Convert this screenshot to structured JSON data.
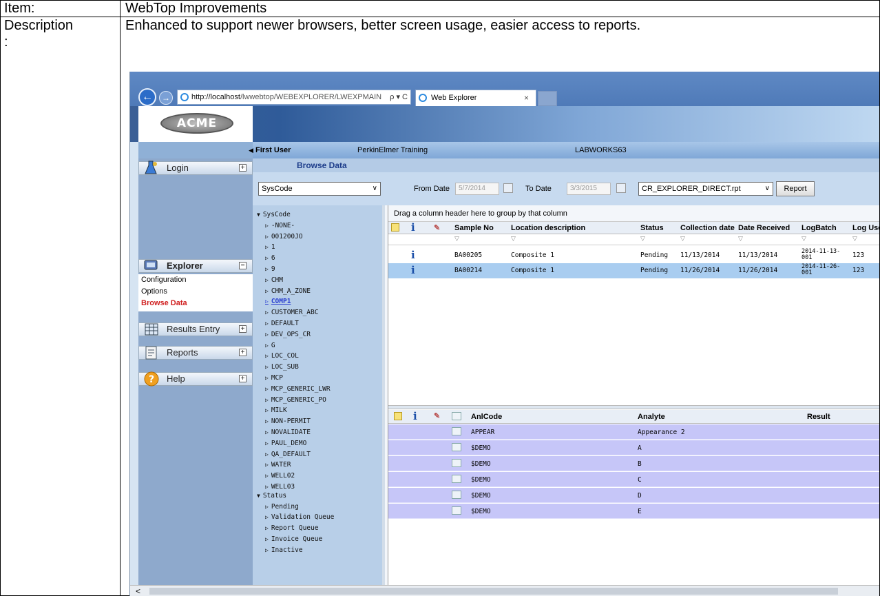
{
  "doc": {
    "item_label": "Item:",
    "item_value": "WebTop Improvements",
    "desc_label": "Description",
    "desc_colon": ":",
    "desc_value": "Enhanced to support newer browsers, better screen usage, easier access to reports."
  },
  "browser": {
    "url_host": "http://localhost",
    "url_path": "/lwwebtop/WEBEXPLORER/LWEXPMAIN",
    "url_controls": "ρ ▾ C",
    "tab_title": "Web Explorer",
    "tab_close": "×"
  },
  "logo_text": "ACME",
  "sidebar": {
    "items": [
      {
        "label": "Login"
      },
      {
        "label": "Explorer"
      },
      {
        "label": "Results Entry"
      },
      {
        "label": "Reports"
      },
      {
        "label": "Help"
      }
    ],
    "explorer_sub": [
      "Configuration",
      "Options",
      "Browse Data"
    ],
    "expand_plus": "+",
    "collapse_minus": "−"
  },
  "userbar": {
    "user": "First User",
    "org": "PerkinElmer Training",
    "db": "LABWORKS63"
  },
  "browse_title": "Browse Data",
  "filters": {
    "group_select": "SysCode",
    "from_label": "From Date",
    "from_value": "5/7/2014",
    "to_label": "To Date",
    "to_value": "3/3/2015",
    "report_select": "CR_EXPLORER_DIRECT.rpt",
    "report_button": "Report"
  },
  "tree": {
    "root_syscode": "SysCode",
    "syscode_children": [
      "-NONE-",
      "001200JO",
      "1",
      "6",
      "9",
      "CHM",
      "CHM_A_ZONE",
      "COMP1",
      "CUSTOMER_ABC",
      "DEFAULT",
      "DEV_OPS_CR",
      "G",
      "LOC_COL",
      "LOC_SUB",
      "MCP",
      "MCP_GENERIC_LWR",
      "MCP_GENERIC_PO",
      "MILK",
      "NON-PERMIT",
      "NOVALIDATE",
      "PAUL_DEMO",
      "QA_DEFAULT",
      "WATER",
      "WELL02",
      "WELL03"
    ],
    "root_status": "Status",
    "status_children": [
      "Pending",
      "Validation Queue",
      "Report Queue",
      "Invoice Queue",
      "Inactive"
    ]
  },
  "sample_grid": {
    "drop_hint": "Drag a column header here to group by that column",
    "columns": [
      "Sample No",
      "Location description",
      "Status",
      "Collection date",
      "Date Received",
      "LogBatch",
      "Log Use"
    ],
    "rows": [
      {
        "sample": "BA00205",
        "location": "Composite 1",
        "status": "Pending",
        "collected": "11/13/2014",
        "received": "11/13/2014",
        "batch1": "2014-11-13-",
        "batch2": "001",
        "user": "123"
      },
      {
        "sample": "BA00214",
        "location": "Composite 1",
        "status": "Pending",
        "collected": "11/26/2014",
        "received": "11/26/2014",
        "batch1": "2014-11-26-",
        "batch2": "001",
        "user": "123"
      }
    ]
  },
  "analyte_grid": {
    "columns": [
      "AnlCode",
      "Analyte",
      "Result"
    ],
    "rows": [
      {
        "code": "APPEAR",
        "analyte": "Appearance 2"
      },
      {
        "code": "$DEMO",
        "analyte": "A"
      },
      {
        "code": "$DEMO",
        "analyte": "B"
      },
      {
        "code": "$DEMO",
        "analyte": "C"
      },
      {
        "code": "$DEMO",
        "analyte": "D"
      },
      {
        "code": "$DEMO",
        "analyte": "E"
      }
    ]
  },
  "glyphs": {
    "info": "i",
    "filter": "▽",
    "expand": "▷",
    "open": "▼",
    "left": "<",
    "back": "←",
    "fwd": "→",
    "caret": "✔"
  },
  "colors": {
    "accent": "#1c3c8a",
    "selected_row": "#a9cdf0",
    "analyte_row": "#c6c6f8",
    "active_link": "#d02020"
  }
}
